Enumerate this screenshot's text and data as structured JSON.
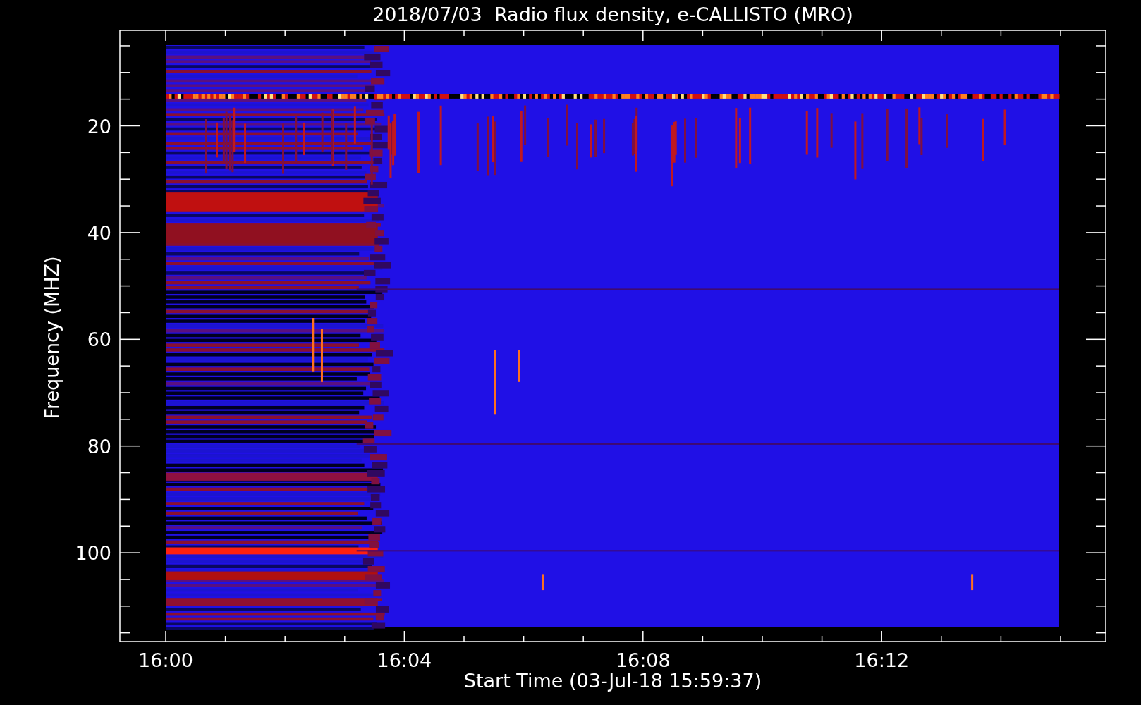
{
  "plot": {
    "title": "2018/07/03  Radio flux density, e-CALLISTO (MRO)",
    "xlabel": "Start Time (03-Jul-18 15:59:37)",
    "ylabel": "Frequency (MHZ)",
    "xticks": [
      "16:00",
      "16:04",
      "16:08",
      "16:12"
    ],
    "yticks": [
      "20",
      "40",
      "60",
      "80",
      "100"
    ]
  }
}
